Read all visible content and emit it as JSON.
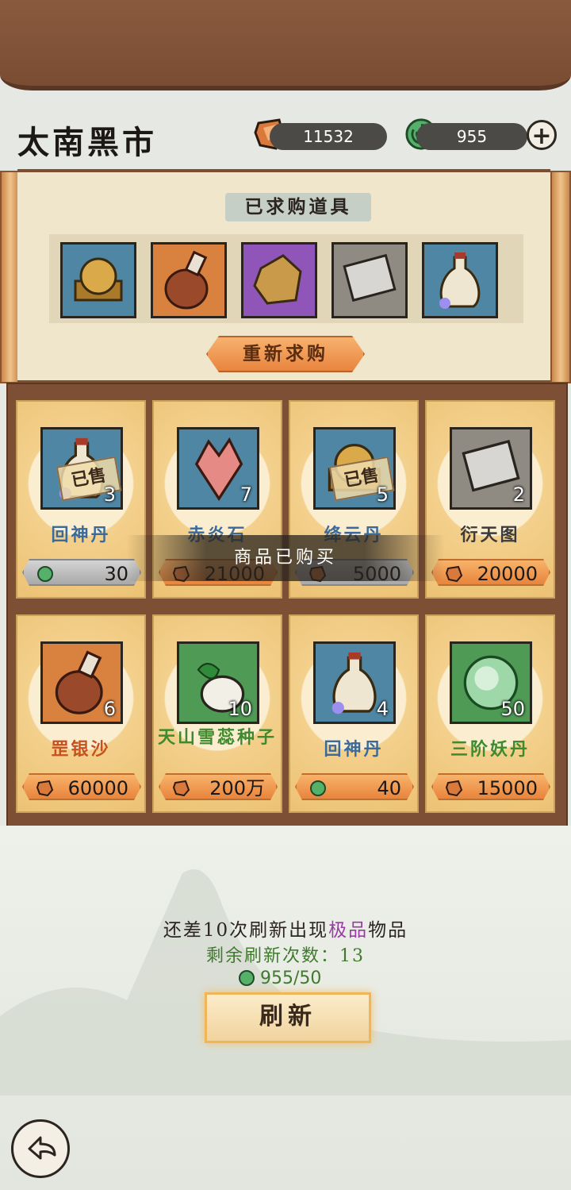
{
  "header": {
    "title": "太南黑市",
    "ore_amount": "11532",
    "jade_amount": "955",
    "plus_icon": "plus-icon"
  },
  "scroll": {
    "title": "已求购道具",
    "items": [
      {
        "icon": "golden-orb-box-icon",
        "color": "#4f86a3"
      },
      {
        "icon": "gourd-bottle-icon",
        "color": "#d9823f"
      },
      {
        "icon": "gold-ore-icon",
        "color": "#8f55b8"
      },
      {
        "icon": "scroll-map-icon",
        "color": "#8f8a82"
      },
      {
        "icon": "white-vase-icon",
        "color": "#4f86a3"
      }
    ],
    "rebuy_label": "重新求购"
  },
  "cards": [
    {
      "name": "回神丹",
      "qty": "3",
      "price": "30",
      "currency": "jade",
      "sold": true,
      "sold_label": "已售",
      "name_color": "#3b6a9a",
      "icon_bg": "#4f86a3",
      "icon": "white-vase-icon"
    },
    {
      "name": "赤炎石",
      "qty": "7",
      "price": "21000",
      "currency": "ore",
      "sold": false,
      "name_color": "#3b6a9a",
      "icon_bg": "#4f86a3",
      "icon": "red-crystal-icon"
    },
    {
      "name": "绛云丹",
      "qty": "5",
      "price": "5000",
      "currency": "ore",
      "sold": true,
      "sold_label": "已售",
      "name_color": "#3b6a9a",
      "icon_bg": "#4f86a3",
      "icon": "golden-orb-box-icon"
    },
    {
      "name": "衍天图",
      "qty": "2",
      "price": "20000",
      "currency": "ore",
      "sold": false,
      "name_color": "#3b3b3b",
      "icon_bg": "#8f8a82",
      "icon": "scroll-map-icon"
    },
    {
      "name": "罡银沙",
      "qty": "6",
      "price": "60000",
      "currency": "ore",
      "sold": false,
      "name_color": "#c8501f",
      "icon_bg": "#d9823f",
      "icon": "gourd-bottle-icon"
    },
    {
      "name": "天山雪蕊种子",
      "qty": "10",
      "price": "200万",
      "currency": "ore",
      "sold": false,
      "name_color": "#3f8a2e",
      "icon_bg": "#4f9a55",
      "icon": "seed-pouch-icon"
    },
    {
      "name": "回神丹",
      "qty": "4",
      "price": "40",
      "currency": "jade",
      "sold": false,
      "name_color": "#3b6a9a",
      "icon_bg": "#4f86a3",
      "icon": "white-vase-icon"
    },
    {
      "name": "三阶妖丹",
      "qty": "50",
      "price": "15000",
      "currency": "ore",
      "sold": false,
      "name_color": "#3f8a2e",
      "icon_bg": "#4f9a55",
      "icon": "green-orb-icon"
    }
  ],
  "toast": "商品已购买",
  "refresh": {
    "hint_prefix": "还差10次刷新出现",
    "hint_highlight": "极品",
    "hint_suffix": "物品",
    "remaining": "剩余刷新次数：13",
    "cost": "955/50",
    "button_label": "刷新"
  },
  "back_icon": "back-arrow-icon"
}
